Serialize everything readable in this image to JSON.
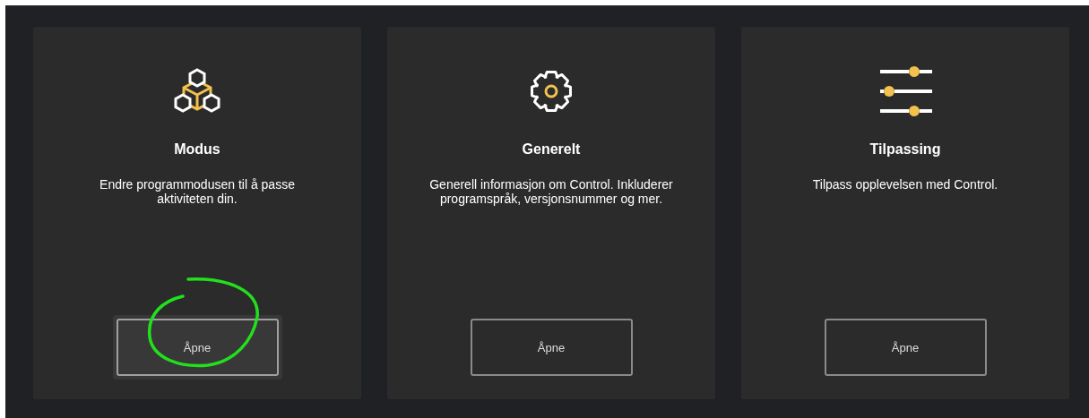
{
  "cards": [
    {
      "title": "Modus",
      "description": "Endre programmodusen til å passe aktiviteten din.",
      "button": "Åpne",
      "highlighted": true
    },
    {
      "title": "Generelt",
      "description": "Generell informasjon om Control. Inkluderer programspråk, versjonsnummer og mer.",
      "button": "Åpne",
      "highlighted": false
    },
    {
      "title": "Tilpassing",
      "description": "Tilpass opplevelsen med Control.",
      "button": "Åpne",
      "highlighted": false
    }
  ]
}
